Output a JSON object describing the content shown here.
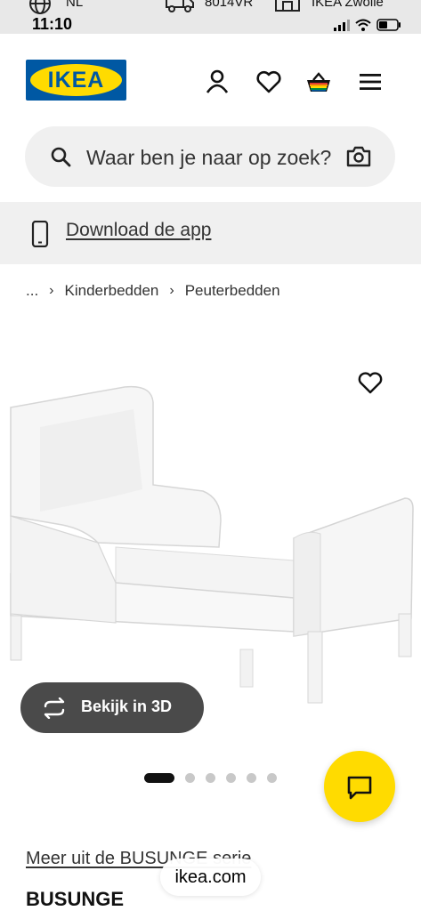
{
  "status_bar": {
    "language": "NL",
    "postal_code": "8014VR",
    "store": "IKEA Zwolle",
    "time": "11:10"
  },
  "header": {
    "logo_text": "IKEA",
    "icons": [
      "account-icon",
      "heart-icon",
      "basket-icon",
      "menu-icon"
    ]
  },
  "search": {
    "placeholder": "Waar ben je naar op zoek?"
  },
  "app_banner": {
    "label": "Download de app"
  },
  "breadcrumb": {
    "items": [
      "...",
      "Kinderbedden",
      "Peuterbedden"
    ]
  },
  "product": {
    "view_3d_label": "Bekijk in 3D",
    "carousel_count": 6,
    "carousel_active": 0,
    "series_link": "Meer uit de BUSUNGE serie",
    "name": "BUSUNGE"
  },
  "browser": {
    "url": "ikea.com"
  },
  "colors": {
    "brand_blue": "#0058a3",
    "brand_yellow": "#ffdb00",
    "banner_bg": "#f0f0f0"
  }
}
